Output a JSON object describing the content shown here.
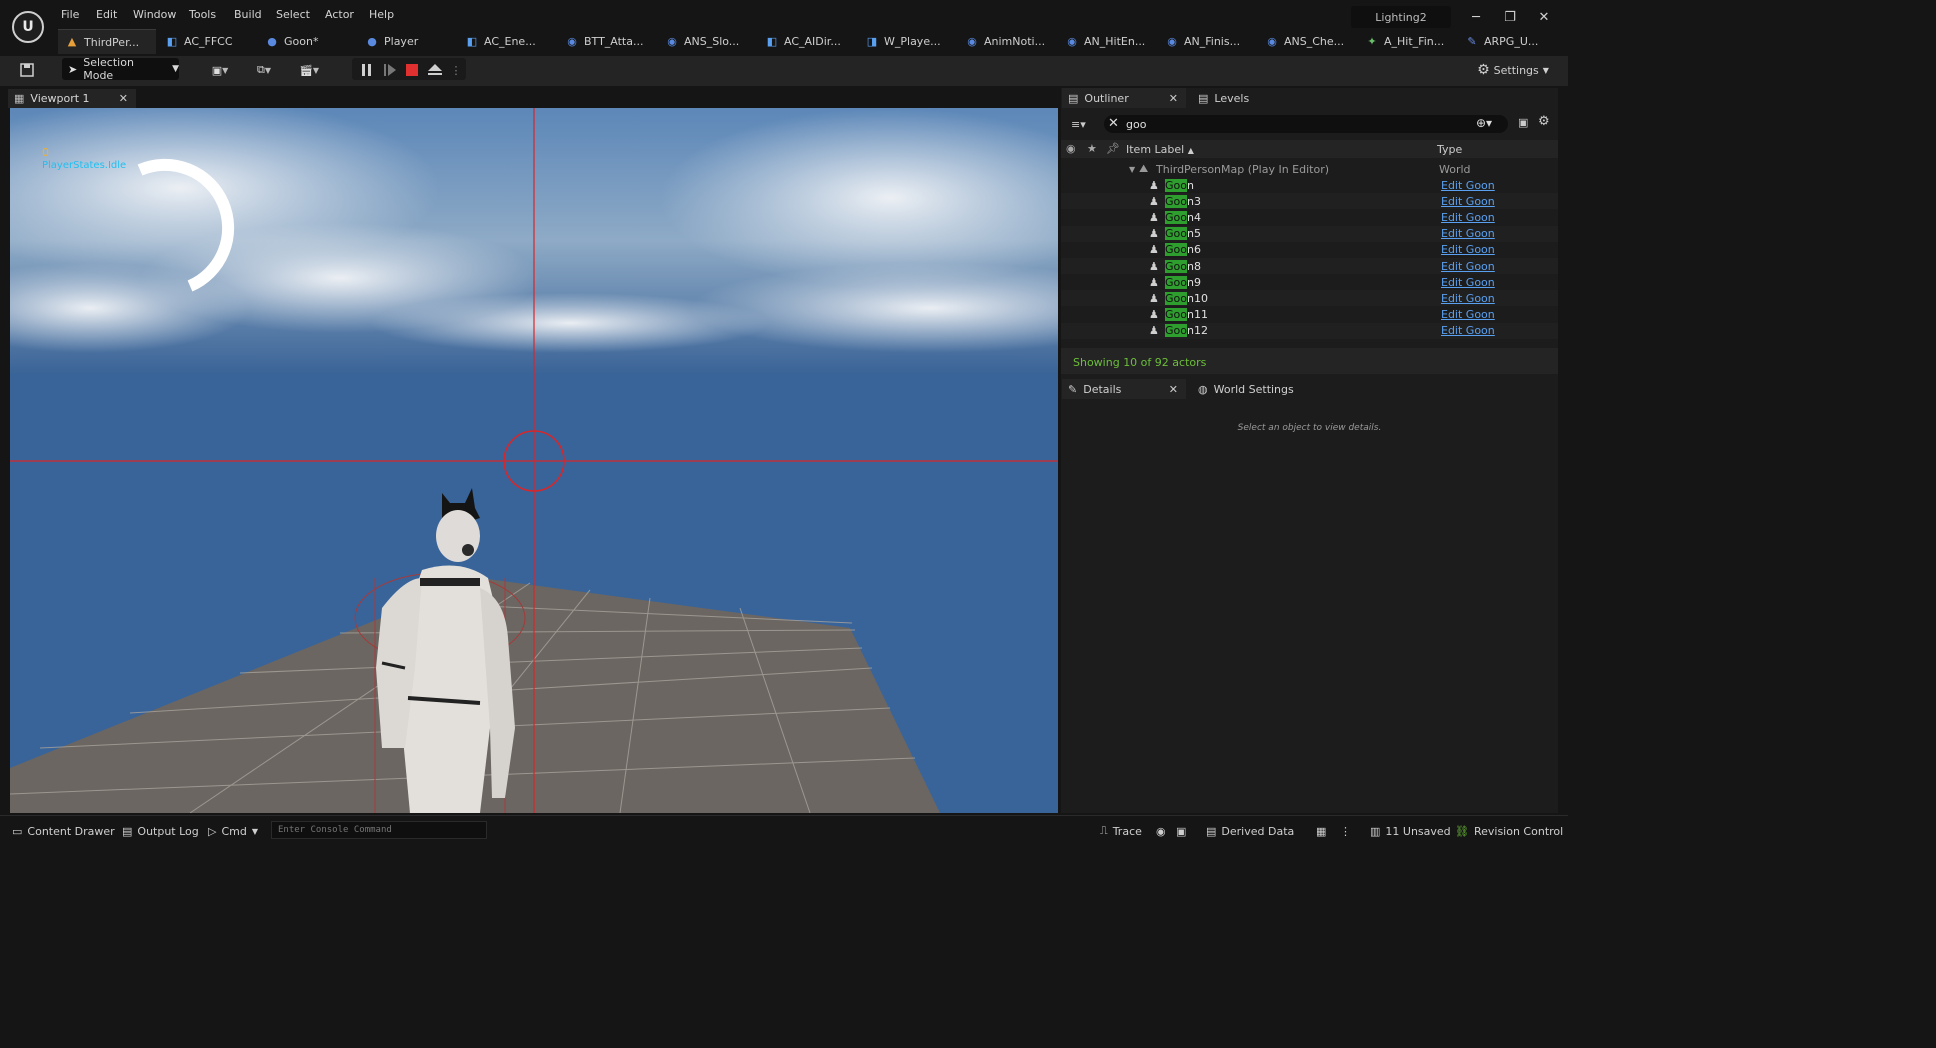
{
  "menu": [
    "File",
    "Edit",
    "Window",
    "Tools",
    "Build",
    "Select",
    "Actor",
    "Help"
  ],
  "project_name": "Lighting2",
  "tabs": [
    {
      "label": "ThirdPer...",
      "icon": "level-icon"
    },
    {
      "label": "AC_FFCC",
      "icon": "component-icon"
    },
    {
      "label": "Goon*",
      "icon": "character-icon"
    },
    {
      "label": "Player",
      "icon": "character-icon"
    },
    {
      "label": "AC_Ene...",
      "icon": "component-icon"
    },
    {
      "label": "BTT_Atta...",
      "icon": "blueprint-icon"
    },
    {
      "label": "ANS_Slo...",
      "icon": "blueprint-icon"
    },
    {
      "label": "AC_AIDir...",
      "icon": "component-icon"
    },
    {
      "label": "W_Playe...",
      "icon": "widget-icon"
    },
    {
      "label": "AnimNoti...",
      "icon": "blueprint-icon"
    },
    {
      "label": "AN_HitEn...",
      "icon": "blueprint-icon"
    },
    {
      "label": "AN_Finis...",
      "icon": "blueprint-icon"
    },
    {
      "label": "ANS_Che...",
      "icon": "blueprint-icon"
    },
    {
      "label": "A_Hit_Fin...",
      "icon": "animation-icon"
    },
    {
      "label": "ARPG_U...",
      "icon": "struct-icon"
    }
  ],
  "toolbar": {
    "selection_mode": "Selection Mode",
    "settings": "Settings"
  },
  "viewport": {
    "tab_label": "Viewport 1",
    "debug_number": "0",
    "debug_state": "PlayerStates.Idle"
  },
  "outliner": {
    "tab_label": "Outliner",
    "levels_tab": "Levels",
    "search_value": "goo",
    "col_label": "Item Label",
    "col_type": "Type",
    "world_row": {
      "label": "ThirdPersonMap (Play In Editor)",
      "type": "World"
    },
    "items": [
      {
        "match": "Goo",
        "rest": "n",
        "type": "Edit Goon"
      },
      {
        "match": "Goo",
        "rest": "n3",
        "type": "Edit Goon"
      },
      {
        "match": "Goo",
        "rest": "n4",
        "type": "Edit Goon"
      },
      {
        "match": "Goo",
        "rest": "n5",
        "type": "Edit Goon"
      },
      {
        "match": "Goo",
        "rest": "n6",
        "type": "Edit Goon"
      },
      {
        "match": "Goo",
        "rest": "n8",
        "type": "Edit Goon"
      },
      {
        "match": "Goo",
        "rest": "n9",
        "type": "Edit Goon"
      },
      {
        "match": "Goo",
        "rest": "n10",
        "type": "Edit Goon"
      },
      {
        "match": "Goo",
        "rest": "n11",
        "type": "Edit Goon"
      },
      {
        "match": "Goo",
        "rest": "n12",
        "type": "Edit Goon"
      }
    ],
    "footer": "Showing 10 of 92 actors"
  },
  "details": {
    "tab_label": "Details",
    "world_settings_tab": "World Settings",
    "empty_message": "Select an object to view details."
  },
  "statusbar": {
    "content_drawer": "Content Drawer",
    "output_log": "Output Log",
    "cmd": "Cmd",
    "console_placeholder": "Enter Console Command",
    "trace": "Trace",
    "derived_data": "Derived Data",
    "unsaved": "11 Unsaved",
    "revision_control": "Revision Control"
  },
  "colors": {
    "accent_green": "#2e9e2e",
    "link_blue": "#5aa0f0",
    "record_red": "#e03030",
    "sky": "#39649a"
  }
}
